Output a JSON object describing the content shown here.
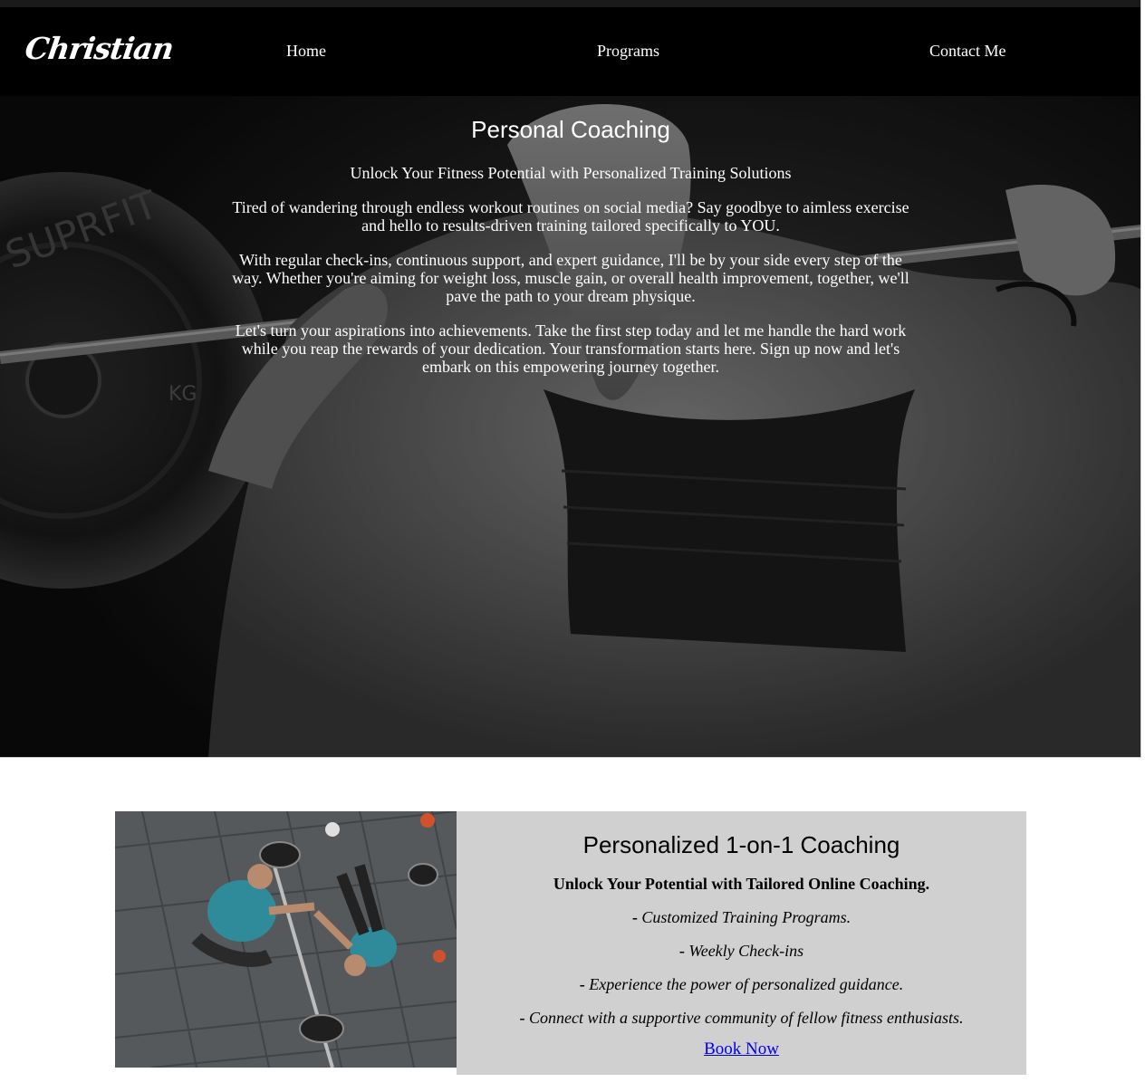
{
  "brand": {
    "logo_text": "Christian"
  },
  "nav": {
    "items": [
      {
        "label": "Home"
      },
      {
        "label": "Programs"
      },
      {
        "label": "Contact Me"
      }
    ]
  },
  "hero": {
    "title": "Personal Coaching",
    "subtitle": "Unlock Your Fitness Potential with Personalized Training Solutions",
    "paragraphs": [
      "Tired of wandering through endless workout routines on social media? Say goodbye to aimless exercise and hello to results-driven training tailored specifically to YOU.",
      "With regular check-ins, continuous support, and expert guidance, I'll be by your side every step of the way. Whether you're aiming for weight loss, muscle gain, or overall health improvement, together, we'll pave the path to your dream physique.",
      "Let's turn your aspirations into achievements. Take the first step today and let me handle the hard work while you reap the rewards of your dedication. Your transformation starts here. Sign up now and let's embark on this empowering journey together."
    ],
    "plate_text": "SUPRFIT",
    "plate_kg": "KG"
  },
  "coaching_card": {
    "title": "Personalized 1-on-1 Coaching",
    "subtitle": "Unlock Your Potential with Tailored Online Coaching.",
    "bullet": "-",
    "features": [
      "Customized Training Programs.",
      "Weekly Check-ins",
      "Experience the power of personalized guidance.",
      "Connect with a supportive community of fellow fitness enthusiasts."
    ],
    "cta_label": "Book Now"
  },
  "colors": {
    "nav_bg": "#000000",
    "card_bg": "#d1d0d1",
    "link": "#0000ee",
    "text_light": "#ffffff"
  }
}
